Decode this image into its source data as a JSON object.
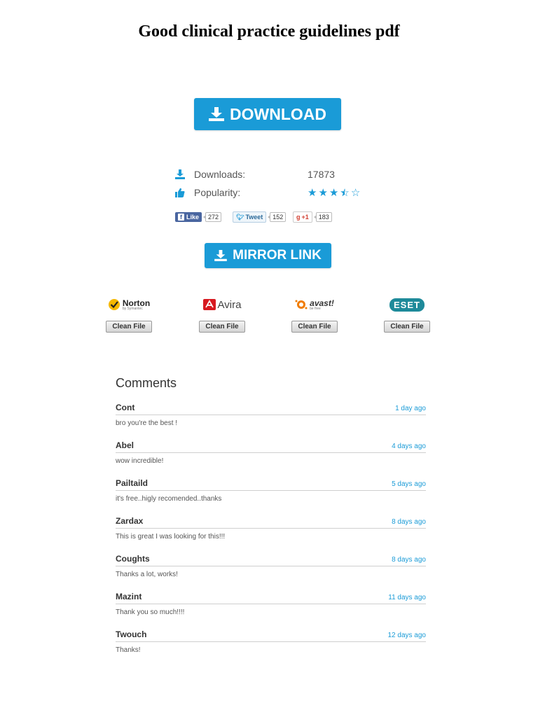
{
  "page": {
    "title": "Good clinical practice guidelines pdf"
  },
  "download": {
    "label": "DOWNLOAD",
    "icon": "download-icon"
  },
  "stats": {
    "downloads_label": "Downloads:",
    "downloads_value": "17873",
    "popularity_label": "Popularity:",
    "popularity_rating": 3.5,
    "popularity_max": 5
  },
  "social": {
    "facebook": {
      "label": "Like",
      "count": "272"
    },
    "twitter": {
      "label": "Tweet",
      "count": "152"
    },
    "google": {
      "label": "+1",
      "count": "183"
    }
  },
  "mirror": {
    "label": "MIRROR LINK",
    "icon": "download-icon"
  },
  "antivirus": [
    {
      "name": "Norton",
      "sub": "by Symantec",
      "button": "Clean File",
      "color": "#f5b800"
    },
    {
      "name": "Avira",
      "button": "Clean File",
      "color": "#d71920"
    },
    {
      "name": "avast!",
      "sub": "be free",
      "button": "Clean File",
      "color": "#f07c00"
    },
    {
      "name": "eset",
      "button": "Clean File",
      "color": "#1e8a9a"
    }
  ],
  "comments": {
    "heading": "Comments",
    "items": [
      {
        "name": "Cont",
        "time": "1 day ago",
        "text": "bro you're the best !"
      },
      {
        "name": "Abel",
        "time": "4 days ago",
        "text": "wow incredible!"
      },
      {
        "name": "Pailtaild",
        "time": "5 days ago",
        "text": "it's free..higly recomended..thanks"
      },
      {
        "name": "Zardax",
        "time": "8 days ago",
        "text": "This is great I was looking for this!!!"
      },
      {
        "name": "Coughts",
        "time": "8 days ago",
        "text": "Thanks a lot, works!"
      },
      {
        "name": "Mazint",
        "time": "11 days ago",
        "text": "Thank you so much!!!!"
      },
      {
        "name": "Twouch",
        "time": "12 days ago",
        "text": "Thanks!"
      }
    ]
  },
  "colors": {
    "accent": "#1a9bd7"
  }
}
